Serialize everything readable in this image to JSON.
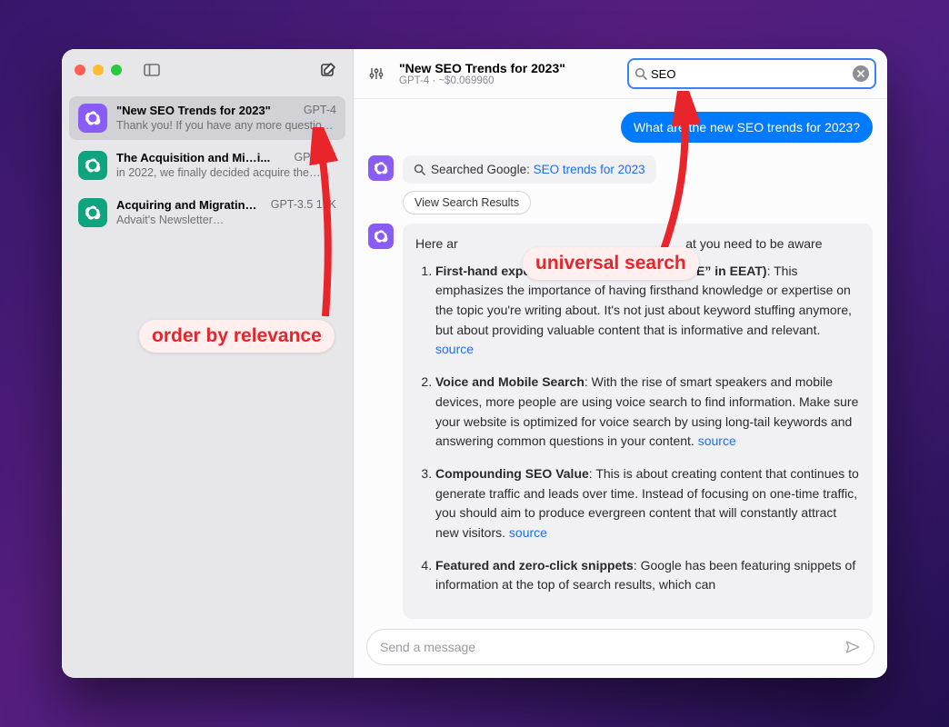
{
  "sidebar": {
    "items": [
      {
        "title": "\"New SEO Trends for 2023\"",
        "model": "GPT-4",
        "preview": "Thank you! If you have any more questio…",
        "iconColor": "purple",
        "active": true
      },
      {
        "title": "The Acquisition and Mi…i...",
        "model": "GPT-3.5",
        "preview": "in 2022, we finally decided   acquire the…",
        "iconColor": "green",
        "active": false
      },
      {
        "title": "Acquiring and Migratin…",
        "model": "GPT-3.5 16K",
        "preview": "Advait's Newsletter…",
        "iconColor": "green",
        "active": false
      }
    ]
  },
  "header": {
    "title": "\"New SEO Trends for 2023\"",
    "subtitle": "GPT-4 · ~$0.069960"
  },
  "search": {
    "value": "SEO"
  },
  "chat": {
    "userMessage": "What are the new SEO trends for 2023?",
    "searched_prefix": "Searched Google: ",
    "searched_query": "SEO trends for 2023",
    "viewResults": "View Search Results",
    "intro_before": "Here ar",
    "intro_after": "at you need to be aware ",
    "points": [
      {
        "title": "First-hand experience on a topic (the new “E” in EEAT)",
        "body": ": This emphasizes the importance of having firsthand knowledge or expertise on the topic you're writing about. It's not just about keyword stuffing anymore, but about providing valuable content that is informative and relevant. ",
        "source": "source"
      },
      {
        "title": "Voice and Mobile Search",
        "body": ": With the rise of smart speakers and mobile devices, more people are using voice search to find information. Make sure your website is optimized for voice search by using long-tail keywords and answering common questions in your content. ",
        "source": "source"
      },
      {
        "title": "Compounding SEO Value",
        "body": ": This is about creating content that continues to generate traffic and leads over time. Instead of focusing on one-time traffic, you should aim to produce evergreen content that will constantly attract new visitors. ",
        "source": "source"
      },
      {
        "title": "Featured and zero-click snippets",
        "body": ": Google has been featuring snippets of information at the top of search results, which can",
        "source": ""
      }
    ]
  },
  "composer": {
    "placeholder": "Send a message"
  },
  "annotations": {
    "relevance": "order by relevance",
    "universal": "universal search"
  }
}
